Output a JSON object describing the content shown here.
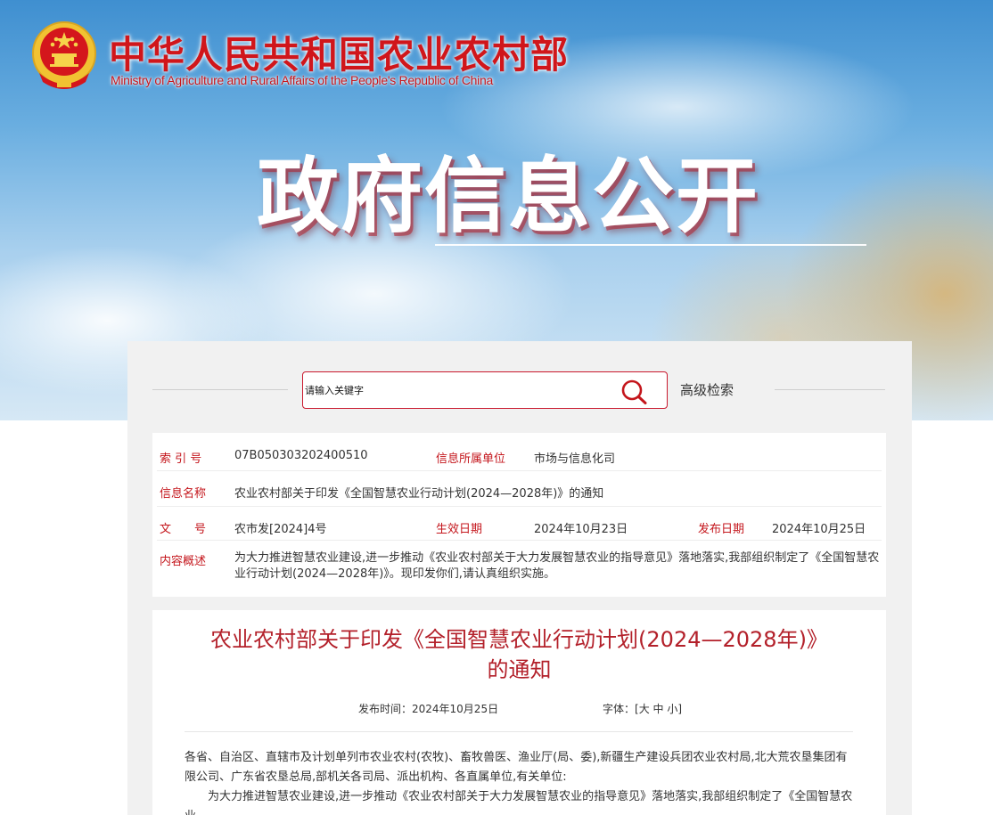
{
  "header": {
    "title": "中华人民共和国农业农村部",
    "subtitle": "Ministry of Agriculture and Rural Affairs of the People's Republic of China",
    "section_title": "政府信息公开",
    "emblem_icon": "national-emblem-icon"
  },
  "search": {
    "placeholder": "请输入关键字",
    "advanced_label": "高级检索",
    "icon": "search-icon"
  },
  "info": {
    "index_label": "索 引 号",
    "index_value": "07B050303202400510",
    "org_label": "信息所属单位",
    "org_value": "市场与信息化司",
    "name_label": "信息名称",
    "name_value": "农业农村部关于印发《全国智慧农业行动计划(2024—2028年)》的通知",
    "doc_label": "文　　号",
    "doc_value": "农市发[2024]4号",
    "effective_label": "生效日期",
    "effective_value": "2024年10月23日",
    "publish_label": "发布日期",
    "publish_value": "2024年10月25日",
    "summary_label": "内容概述",
    "summary_value": "为大力推进智慧农业建设,进一步推动《农业农村部关于大力发展智慧农业的指导意见》落地落实,我部组织制定了《全国智慧农业行动计划(2024—2028年)》。现印发你们,请认真组织实施。"
  },
  "article": {
    "title_line1": "农业农村部关于印发《全国智慧农业行动计划(2024—2028年)》",
    "title_line2": "的通知",
    "publish_time": "发布时间：2024年10月25日",
    "font_label": "字体：",
    "font_open": "[",
    "font_large": "大",
    "font_medium": "中",
    "font_small": "小",
    "font_close": "]",
    "paragraph1": "各省、自治区、直辖市及计划单列市农业农村(农牧)、畜牧兽医、渔业厅(局、委),新疆生产建设兵团农业农村局,北大荒农垦集团有限公司、广东省农垦总局,部机关各司局、派出机构、各直属单位,有关单位:",
    "paragraph2": "为大力推进智慧农业建设,进一步推动《农业农村部关于大力发展智慧农业的指导意见》落地落实,我部组织制定了《全国智慧农业"
  },
  "colors": {
    "brand_red": "#c4161c",
    "title_red": "#b3202a"
  }
}
